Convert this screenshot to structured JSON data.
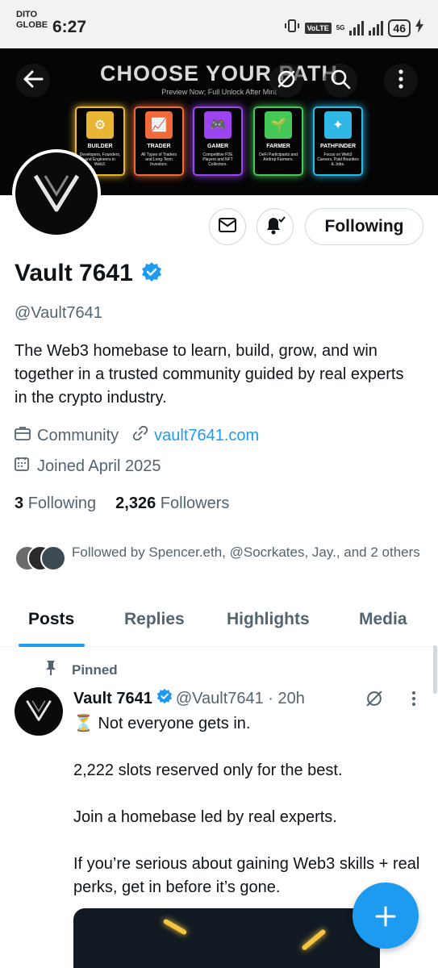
{
  "status_bar": {
    "carrier_line1": "DITO",
    "carrier_line2": "GLOBE",
    "time": "6:27",
    "volte": "VoLTE",
    "net_type": "5G",
    "battery": "46"
  },
  "banner": {
    "title": "CHOOSE YOUR PATH",
    "subtitle": "Preview Now; Full Unlock After Mint",
    "cards": [
      {
        "name": "BUILDER",
        "desc": "Developers, Founders, and Engineers in Web3.",
        "color": "#e9b634"
      },
      {
        "name": "TRADER",
        "desc": "All Types of Traders and Long-Term Investors.",
        "color": "#f06a3a"
      },
      {
        "name": "GAMER",
        "desc": "Competitive P2E Players and NFT Collectors.",
        "color": "#9b44ef"
      },
      {
        "name": "FARMER",
        "desc": "DeFi Participants and Airdrop Farmers.",
        "color": "#45c75a"
      },
      {
        "name": "PATHFINDER",
        "desc": "Focus on Web3 Careers, Paid Bounties & Jobs.",
        "color": "#2fb8e6"
      }
    ]
  },
  "profile": {
    "name": "Vault 7641",
    "handle": "@Vault7641",
    "bio": "The Web3 homebase to learn, build, grow, and win together in a trusted community guided by real experts in the crypto industry.",
    "category": "Community",
    "website": "vault7641.com",
    "joined": "Joined April 2025",
    "following_count": "3",
    "following_label": "Following",
    "followers_count": "2,326",
    "followers_label": "Followers",
    "followed_by": "Followed by Spencer.eth, @Socrkates, Jay., and 2 others",
    "follow_button": "Following"
  },
  "tabs": [
    "Posts",
    "Replies",
    "Highlights",
    "Media"
  ],
  "post": {
    "pinned_label": "Pinned",
    "author": "Vault 7641",
    "meta": "@Vault7641 · 20h",
    "lines": [
      "⏳ Not everyone gets in.",
      "2,222 slots reserved only for the best.",
      "Join a homebase led by real experts.",
      "If you’re serious about gaining Web3 skills + real perks, get in before it’s gone."
    ]
  },
  "colors": {
    "accent": "#1d9bf0",
    "text_primary": "#0f1419",
    "text_secondary": "#536471"
  }
}
